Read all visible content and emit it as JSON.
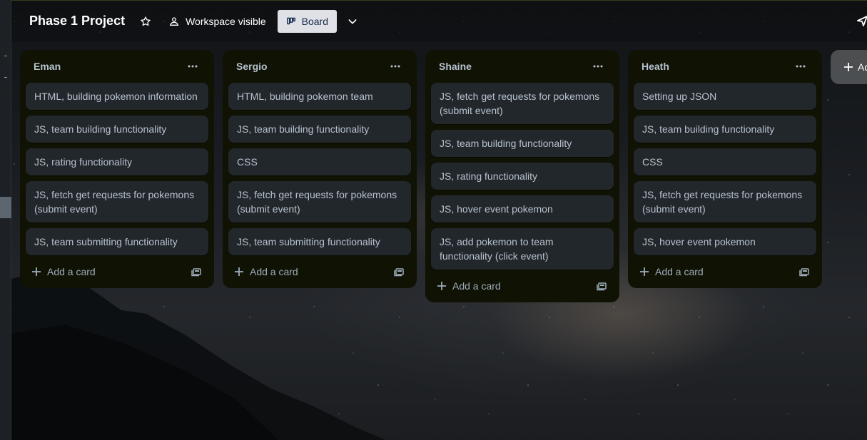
{
  "header": {
    "board_title": "Phase 1 Project",
    "visibility_label": "Workspace visible",
    "view_label": "Board"
  },
  "lists": [
    {
      "title": "Eman",
      "cards": [
        "HTML, building pokemon information",
        "JS, team building functionality",
        "JS, rating functionality",
        "JS, fetch get requests for pokemons (submit event)",
        "JS, team submitting functionality"
      ],
      "add_card_label": "Add a card"
    },
    {
      "title": "Sergio",
      "cards": [
        "HTML, building pokemon team",
        "JS, team building functionality",
        "CSS",
        "JS, fetch get requests for pokemons (submit event)",
        "JS, team submitting functionality"
      ],
      "add_card_label": "Add a card"
    },
    {
      "title": "Shaine",
      "cards": [
        "JS, fetch get requests for pokemons (submit event)",
        "JS, team building functionality",
        "JS, rating functionality",
        "JS, hover event pokemon",
        "JS, add pokemon to team functionality (click event)"
      ],
      "add_card_label": "Add a card"
    },
    {
      "title": "Heath",
      "cards": [
        "Setting up JSON",
        "JS, team building functionality",
        "CSS",
        "JS, fetch get requests for pokemons (submit event)",
        "JS, hover event pokemon"
      ],
      "add_card_label": "Add a card"
    }
  ],
  "add_list_label": "Add another list",
  "icons": {
    "star": "star-icon",
    "visibility": "workspace-people-icon",
    "board_view": "board-view-icon",
    "chevron": "chevron-down-icon",
    "share": "share-icon",
    "list_menu": "more-horizontal-icon",
    "add": "plus-icon",
    "template": "card-template-icon"
  },
  "colors": {
    "list_bg": "#101204",
    "card_bg": "#22272b",
    "text": "#b6c2cf",
    "view_button_bg": "#dfe1e6"
  }
}
